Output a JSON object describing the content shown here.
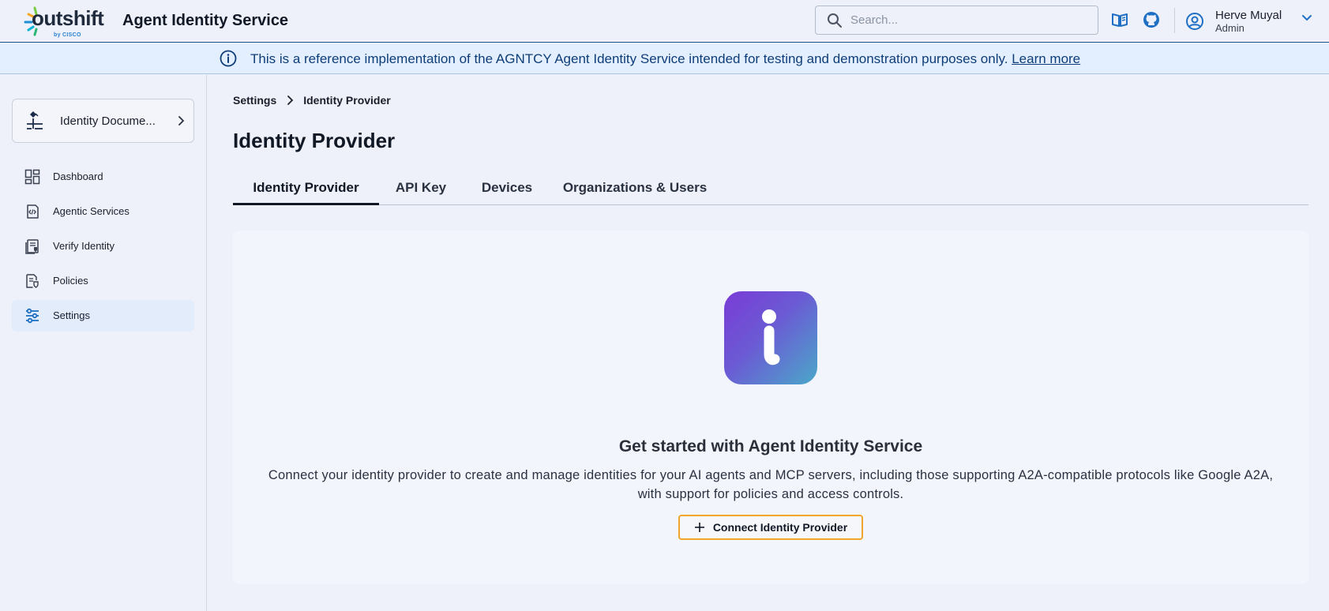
{
  "header": {
    "logo_text": "outshift",
    "logo_sub": "by CISCO",
    "app_title": "Agent Identity Service",
    "search_placeholder": "Search...",
    "docs_icon": "book-icon",
    "github_icon": "github-icon",
    "user": {
      "name": "Herve Muyal",
      "role": "Admin",
      "avatar_icon": "user-circle-icon"
    }
  },
  "banner": {
    "text": "This is a reference implementation of the AGNTCY Agent Identity Service intended for testing and demonstration purposes only.",
    "link": "Learn more",
    "icon": "info-icon"
  },
  "sidebar": {
    "doc_card": {
      "label": "Identity Docume...",
      "icon": "identity-document-icon"
    },
    "items": [
      {
        "label": "Dashboard",
        "icon": "dashboard-icon",
        "active": false
      },
      {
        "label": "Agentic Services",
        "icon": "agentic-services-icon",
        "active": false
      },
      {
        "label": "Verify Identity",
        "icon": "verify-identity-icon",
        "active": false
      },
      {
        "label": "Policies",
        "icon": "policies-icon",
        "active": false
      },
      {
        "label": "Settings",
        "icon": "settings-icon",
        "active": true
      }
    ]
  },
  "breadcrumb": {
    "parent": "Settings",
    "current": "Identity Provider"
  },
  "page_title": "Identity Provider",
  "tabs": [
    {
      "label": "Identity Provider",
      "active": true
    },
    {
      "label": "API Key",
      "active": false
    },
    {
      "label": "Devices",
      "active": false
    },
    {
      "label": "Organizations & Users",
      "active": false
    }
  ],
  "empty_state": {
    "icon": "info-icon",
    "title": "Get started with Agent Identity Service",
    "description": "Connect your identity provider to create and manage identities for your AI agents and MCP servers, including those supporting A2A-compatible protocols like Google A2A, with support for policies and access controls.",
    "button_label": "Connect Identity Provider"
  },
  "colors": {
    "accent": "#0e3d78",
    "banner_bg": "#e3efff",
    "button_border": "#f0a52c",
    "active_nav_bg": "#e2ecfb"
  }
}
